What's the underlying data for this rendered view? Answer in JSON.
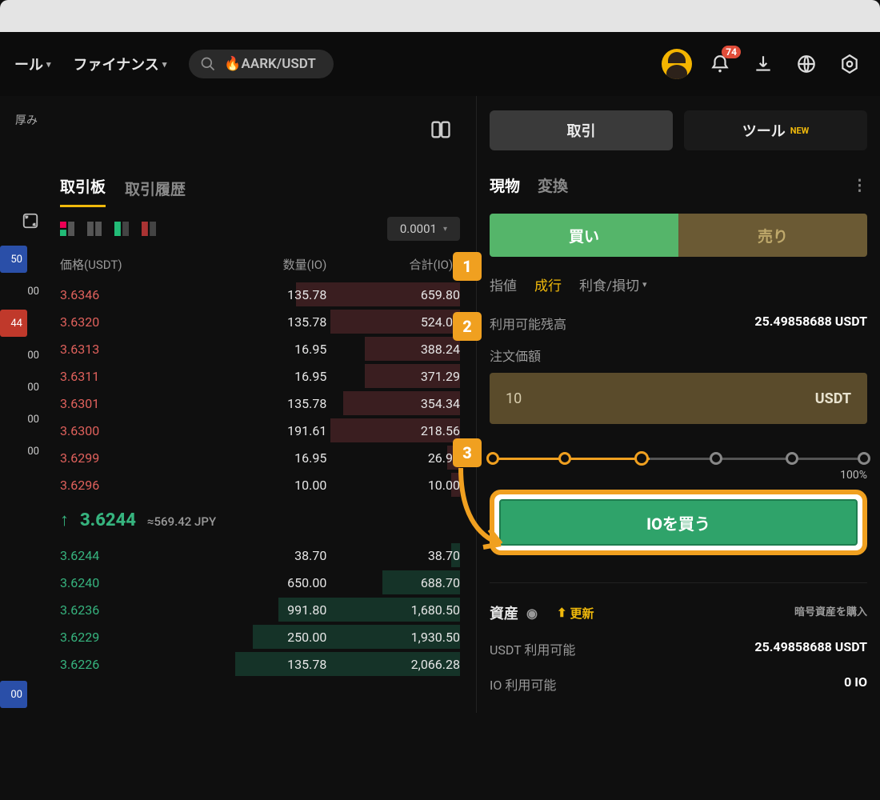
{
  "header": {
    "nav": [
      {
        "label": "ール"
      },
      {
        "label": "ファイナンス"
      }
    ],
    "search": {
      "fire": "🔥",
      "pair": "AARK/USDT"
    },
    "notif_count": "74"
  },
  "left_stubs": [
    {
      "text": "厚み",
      "cls": ""
    },
    {
      "text": "50",
      "cls": "blue"
    },
    {
      "text": "00",
      "cls": ""
    },
    {
      "text": "44",
      "cls": "red"
    },
    {
      "text": "00",
      "cls": ""
    },
    {
      "text": "00",
      "cls": ""
    },
    {
      "text": "00",
      "cls": ""
    },
    {
      "text": "00",
      "cls": ""
    },
    {
      "text": "00",
      "cls": "blue"
    }
  ],
  "orderbook": {
    "tabs": {
      "book": "取引板",
      "history": "取引履歴"
    },
    "precision": "0.0001",
    "columns": {
      "price": "価格(USDT)",
      "amount": "数量(IO)",
      "total": "合計(IO)"
    },
    "asks": [
      {
        "price": "3.6346",
        "amount": "135.78",
        "total": "659.80",
        "depth": 38
      },
      {
        "price": "3.6320",
        "amount": "135.78",
        "total": "524.02",
        "depth": 30
      },
      {
        "price": "3.6313",
        "amount": "16.95",
        "total": "388.24",
        "depth": 22
      },
      {
        "price": "3.6311",
        "amount": "16.95",
        "total": "371.29",
        "depth": 22
      },
      {
        "price": "3.6301",
        "amount": "135.78",
        "total": "354.34",
        "depth": 27
      },
      {
        "price": "3.6300",
        "amount": "191.61",
        "total": "218.56",
        "depth": 30
      },
      {
        "price": "3.6299",
        "amount": "16.95",
        "total": "26.95",
        "depth": 3
      },
      {
        "price": "3.6296",
        "amount": "10.00",
        "total": "10.00",
        "depth": 2
      }
    ],
    "mid": {
      "price": "3.6244",
      "fiat": "≈569.42 JPY"
    },
    "bids": [
      {
        "price": "3.6244",
        "amount": "38.70",
        "total": "38.70",
        "depth": 2
      },
      {
        "price": "3.6240",
        "amount": "650.00",
        "total": "688.70",
        "depth": 18
      },
      {
        "price": "3.6236",
        "amount": "991.80",
        "total": "1,680.50",
        "depth": 42
      },
      {
        "price": "3.6229",
        "amount": "250.00",
        "total": "1,930.50",
        "depth": 48
      },
      {
        "price": "3.6226",
        "amount": "135.78",
        "total": "2,066.28",
        "depth": 52
      }
    ]
  },
  "trade": {
    "top_tabs": {
      "trade": "取引",
      "tools": "ツール",
      "new": "NEW"
    },
    "modes": {
      "spot": "現物",
      "convert": "変換"
    },
    "side": {
      "buy": "買い",
      "sell": "売り"
    },
    "order_types": {
      "limit": "指値",
      "market": "成行",
      "stop": "利食/損切"
    },
    "balance_label": "利用可能残高",
    "balance_value": "25.49858688 USDT",
    "amount_label": "注文価額",
    "amount_value": "10",
    "amount_unit": "USDT",
    "slider_max": "100%",
    "cta": "IOを買う",
    "assets": {
      "title": "資産",
      "update": "更新",
      "buy_link": "暗号資産を購入",
      "rows": [
        {
          "label": "USDT 利用可能",
          "value": "25.49858688 USDT"
        },
        {
          "label": "IO 利用可能",
          "value": "0 IO"
        }
      ]
    }
  },
  "steps": {
    "one": "1",
    "two": "2",
    "three": "3"
  }
}
